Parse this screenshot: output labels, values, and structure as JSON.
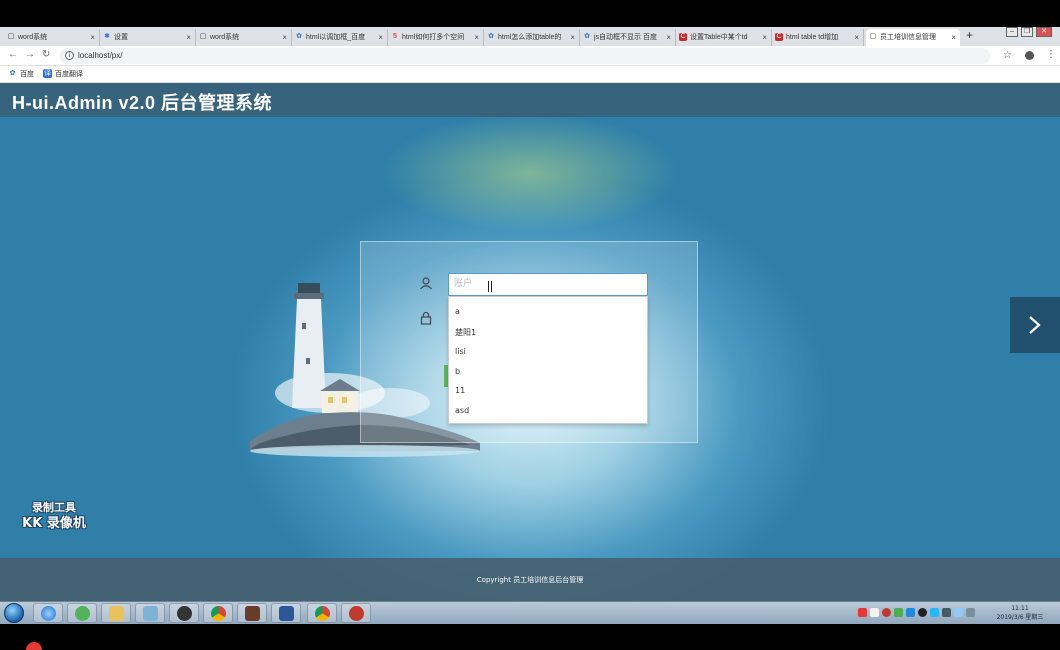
{
  "browser": {
    "tabs": [
      {
        "title": "word系统",
        "icon": "doc"
      },
      {
        "title": "设置",
        "icon": "gear"
      },
      {
        "title": "word系统",
        "icon": "doc"
      },
      {
        "title": "html以调加框_百度",
        "icon": "baidu"
      },
      {
        "title": "html如何打多个空间",
        "icon": "h5"
      },
      {
        "title": "html怎么添加table的",
        "icon": "baidu"
      },
      {
        "title": "js自动框不显示 百度",
        "icon": "baidu"
      },
      {
        "title": "设置Table中某个td",
        "icon": "csdn"
      },
      {
        "title": "html table td增加",
        "icon": "csdn"
      },
      {
        "title": "员工培训信息管理",
        "icon": "doc"
      }
    ],
    "new_tab": "+",
    "close_glyph": "×",
    "url": "localhost/px/",
    "bookmarks": [
      {
        "label": "百度",
        "icon": "baidu"
      },
      {
        "label": "百度翻译",
        "icon": "translate"
      }
    ]
  },
  "page": {
    "header_title": "H-ui.Admin v2.0 后台管理系统",
    "login": {
      "account_placeholder": "账户",
      "suggestions": [
        "a",
        "楚阳1",
        "lisi",
        "b",
        "11",
        "asd"
      ]
    },
    "footer_copyright": "Copyright 员工培训信息后台管理",
    "watermark": {
      "line1": "录制工具",
      "line2": "KK 录像机"
    }
  },
  "taskbar": {
    "time": "11:11",
    "date": "2019/3/6 星期三"
  },
  "colors": {
    "header_bg": "#3c5a6e",
    "input_border": "#5b9bd5",
    "login_button": "#5cb85c",
    "page_bg": "#2f7fa9"
  }
}
